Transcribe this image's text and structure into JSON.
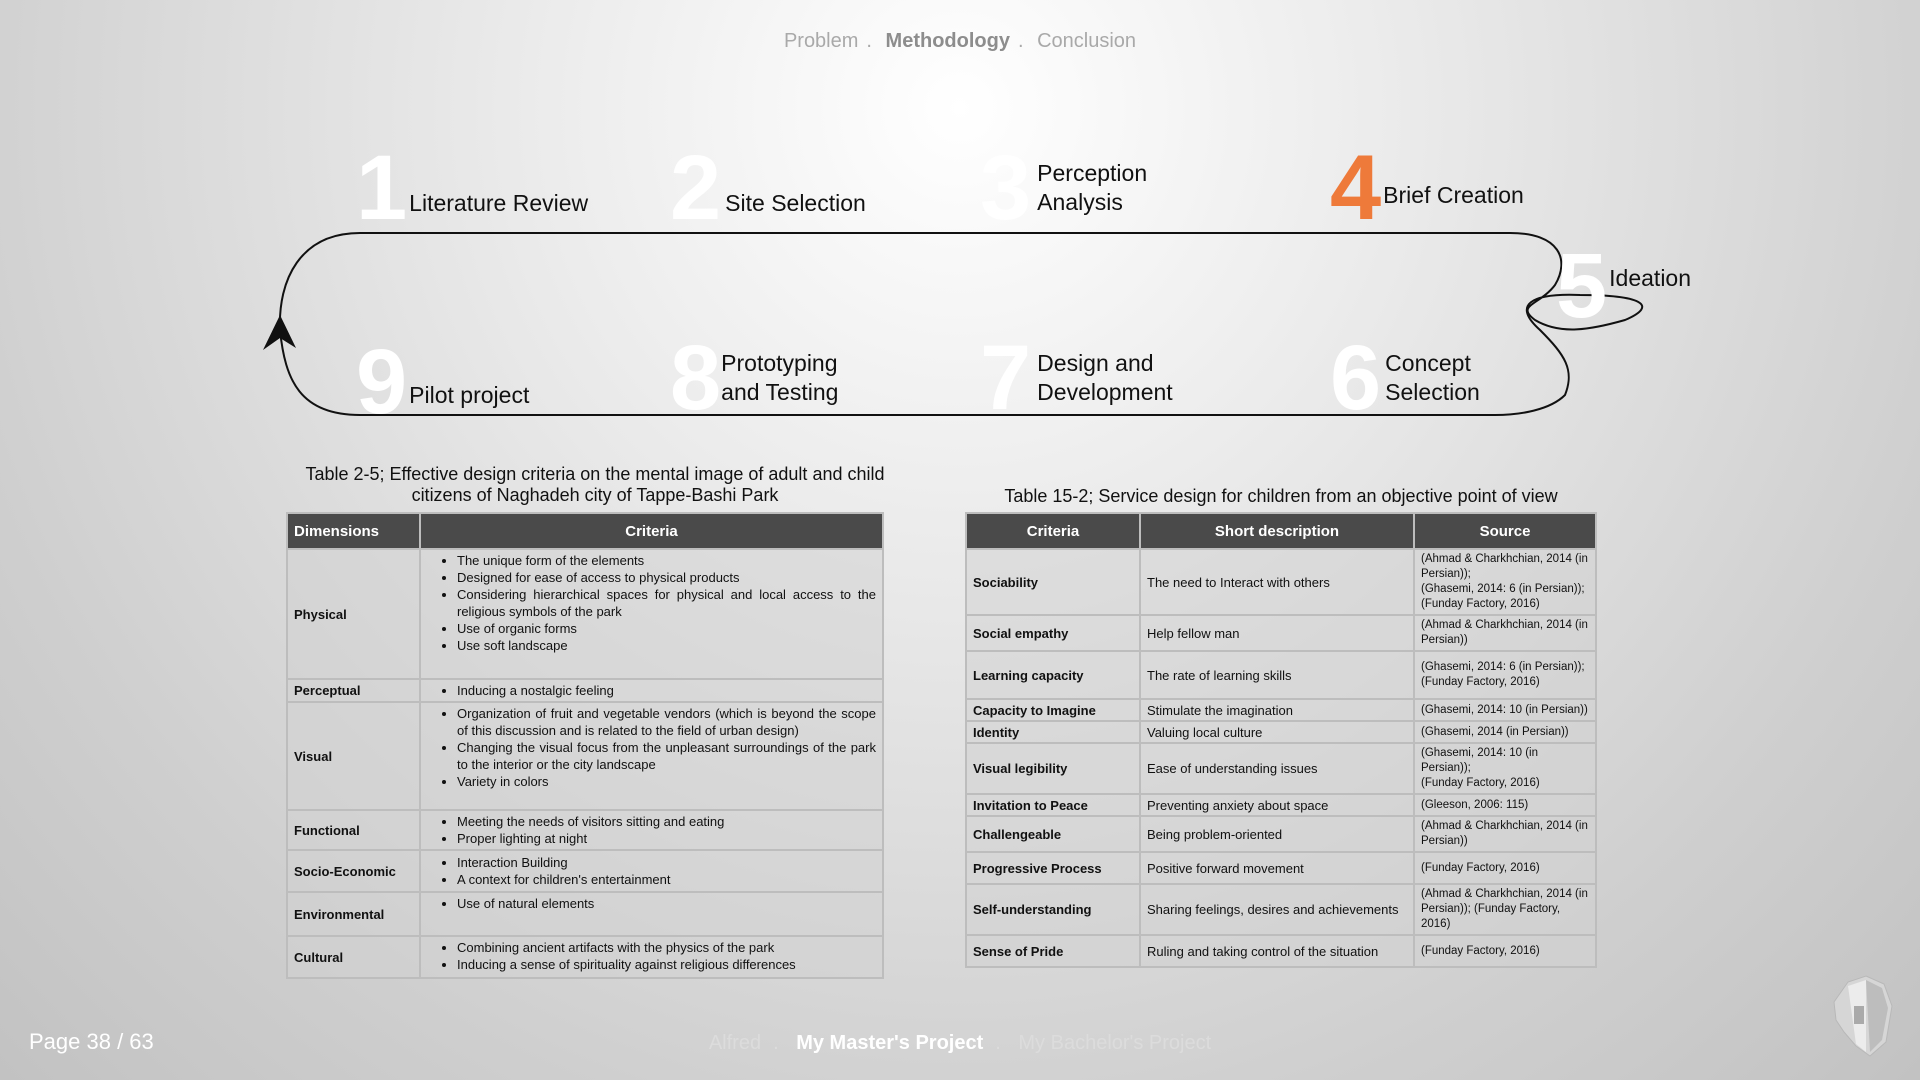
{
  "top_nav": {
    "item1": "Problem",
    "sep1": ".",
    "item2": "Methodology",
    "sep2": ".",
    "item3": "Conclusion"
  },
  "steps": [
    {
      "num": "1",
      "label": "Literature Review"
    },
    {
      "num": "2",
      "label": "Site Selection"
    },
    {
      "num": "3",
      "label": "Perception\nAnalysis"
    },
    {
      "num": "4",
      "label": "Brief Creation"
    },
    {
      "num": "5",
      "label": "Ideation"
    },
    {
      "num": "6",
      "label": "Concept\nSelection"
    },
    {
      "num": "7",
      "label": "Design and\nDevelopment"
    },
    {
      "num": "8",
      "label": "Prototyping\nand Testing"
    },
    {
      "num": "9",
      "label": "Pilot project"
    }
  ],
  "accent_color": "#ee7a3a",
  "table1": {
    "caption": "Table 2-5; Effective design criteria on the mental image of adult and child citizens of Naghadeh city of Tappe-Bashi Park",
    "headers": [
      "Dimensions",
      "Criteria"
    ],
    "rows": [
      {
        "dim": "Physical",
        "items": [
          "The unique form of the elements",
          "Designed for ease of access to physical products",
          "Considering hierarchical spaces for physical and local access to the religious symbols of the park",
          "Use of organic forms",
          "Use soft landscape"
        ]
      },
      {
        "dim": "Perceptual",
        "items": [
          "Inducing a nostalgic feeling"
        ]
      },
      {
        "dim": "Visual",
        "items": [
          "Organization of fruit and vegetable vendors (which is beyond the scope of this discussion and is related to the field of urban design)",
          "Changing the visual focus from the unpleasant surroundings of the park to the interior or the city landscape",
          "Variety in colors"
        ]
      },
      {
        "dim": "Functional",
        "items": [
          "Meeting the needs of visitors sitting and eating",
          "Proper lighting at night"
        ]
      },
      {
        "dim": "Socio-Economic",
        "items": [
          "Interaction Building",
          "A context for children's entertainment"
        ]
      },
      {
        "dim": "Environmental",
        "items": [
          "Use of natural elements"
        ]
      },
      {
        "dim": "Cultural",
        "items": [
          "Combining ancient artifacts with the physics of the park",
          "Inducing a sense of spirituality against religious differences"
        ]
      }
    ]
  },
  "table2": {
    "caption": "Table 15-2; Service design for children from an objective point of view",
    "headers": [
      "Criteria",
      "Short description",
      "Source"
    ],
    "rows": [
      {
        "criteria": "Sociability",
        "desc": "The need to Interact with others",
        "source": "(Ahmad & Charkhchian, 2014 (in Persian));\n(Ghasemi, 2014: 6 (in Persian));\n(Funday Factory, 2016)"
      },
      {
        "criteria": "Social empathy",
        "desc": "Help fellow man",
        "source": "(Ahmad & Charkhchian, 2014 (in Persian))"
      },
      {
        "criteria": "Learning capacity",
        "desc": "The rate of learning skills",
        "source": "(Ghasemi, 2014: 6 (in Persian));\n(Funday Factory, 2016)"
      },
      {
        "criteria": "Capacity to Imagine",
        "desc": "Stimulate the imagination",
        "source": "(Ghasemi, 2014: 10 (in Persian))"
      },
      {
        "criteria": "Identity",
        "desc": "Valuing local culture",
        "source": "(Ghasemi, 2014 (in Persian))"
      },
      {
        "criteria": "Visual legibility",
        "desc": "Ease of understanding issues",
        "source": "(Ghasemi, 2014: 10 (in Persian));\n(Funday Factory, 2016)"
      },
      {
        "criteria": "Invitation to Peace",
        "desc": "Preventing anxiety about space",
        "source": "(Gleeson, 2006: 115)"
      },
      {
        "criteria": "Challengeable",
        "desc": "Being problem-oriented",
        "source": "(Ahmad & Charkhchian, 2014 (in Persian))"
      },
      {
        "criteria": "Progressive Process",
        "desc": "Positive forward movement",
        "source": "(Funday Factory, 2016)"
      },
      {
        "criteria": "Self-understanding",
        "desc": "Sharing feelings, desires and achievements",
        "source": "(Ahmad & Charkhchian, 2014 (in Persian)); (Funday Factory, 2016)"
      },
      {
        "criteria": "Sense of Pride",
        "desc": "Ruling and taking control of the situation",
        "source": "(Funday Factory, 2016)"
      }
    ]
  },
  "footer": {
    "page": "Page 38 / 63",
    "nav1": "Alfred",
    "sep1": ".",
    "nav2": "My Master's Project",
    "sep2": ".",
    "nav3": "My Bachelor's Project"
  }
}
